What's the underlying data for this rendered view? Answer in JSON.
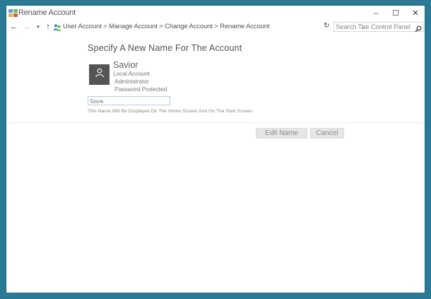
{
  "window": {
    "title": "Rename Account",
    "controls": {
      "minimize": "–",
      "maximize": "☐",
      "close": "✕"
    }
  },
  "nav": {
    "back_glyph": "←",
    "forward_glyph": "→",
    "recent_glyph": "▾",
    "up_glyph": "↑",
    "breadcrumb": "User Account > Manage Account > Change Account > Rename Account",
    "dropdown_glyph": "⌄",
    "refresh_glyph": "↻",
    "search_placeholder": "Search The Control Panel"
  },
  "content": {
    "heading": "Specify A New Name For The  Account",
    "account": {
      "name": "Savior",
      "type": "Local Account",
      "role": "Administrator",
      "protection": "Password Protected"
    },
    "input": {
      "value": "Save",
      "hint": "This Name Will Be Displayed On The Home Screen And On The Start Screen."
    },
    "buttons": {
      "edit": "Edit Name",
      "cancel": "Cancel"
    }
  },
  "colors": {
    "desktop": "#2b7a95",
    "window": "#ffffff",
    "avatar": "#555555",
    "button_bg": "#e6e6e6"
  },
  "icons": {
    "title": "control-panel-icon",
    "address": "users-icon",
    "avatar": "user-silhouette-icon",
    "search": "search-icon"
  }
}
